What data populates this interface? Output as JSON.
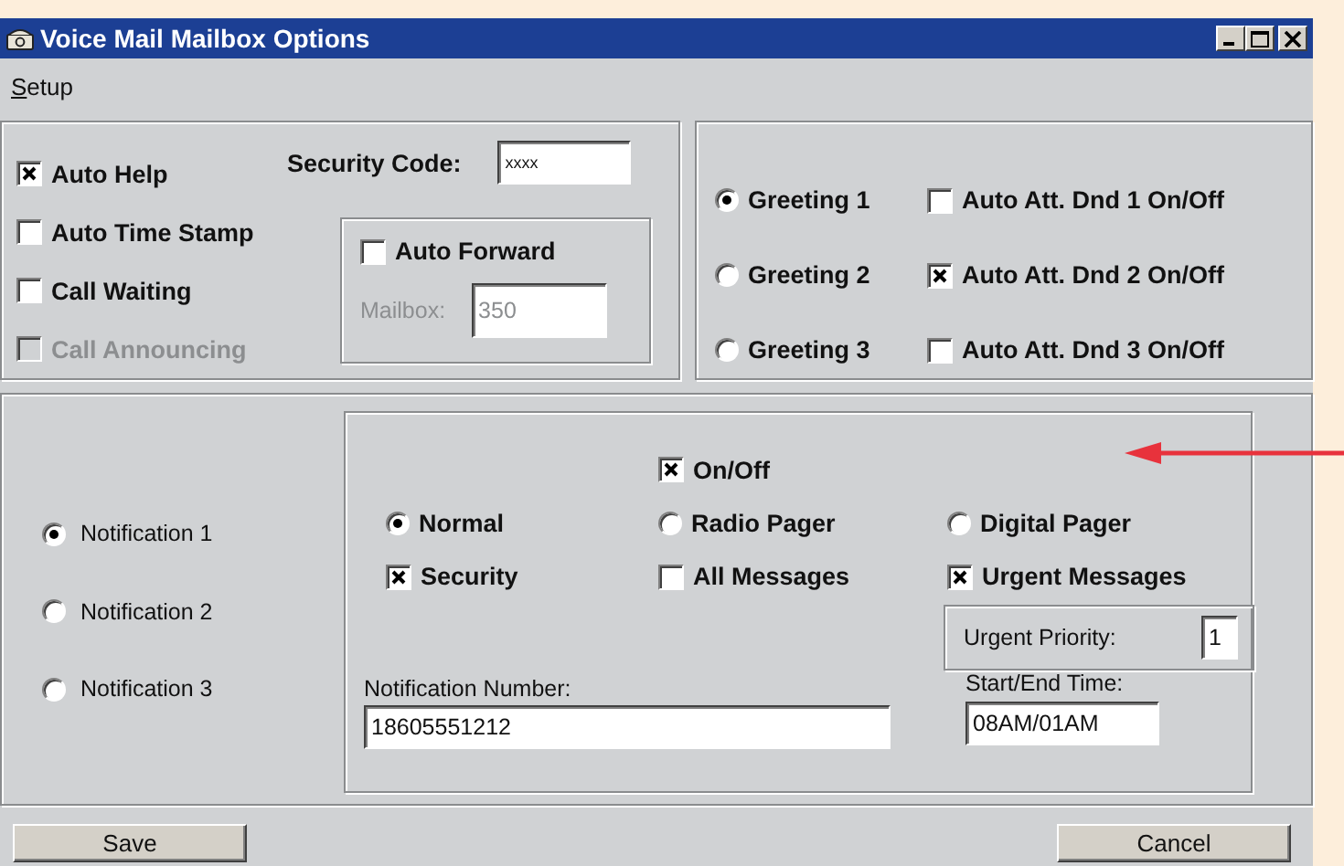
{
  "window": {
    "title": "Voice Mail Mailbox Options"
  },
  "menu": [
    {
      "label": "Setup"
    }
  ],
  "options": [
    {
      "label": "Auto Help",
      "checked": true,
      "disabled": false
    },
    {
      "label": "Auto Time Stamp",
      "checked": false,
      "disabled": false
    },
    {
      "label": "Call Waiting",
      "checked": false,
      "disabled": false
    },
    {
      "label": "Call Announcing",
      "checked": false,
      "disabled": true
    }
  ],
  "security_code": {
    "label": "Security Code:",
    "value": "xxxx"
  },
  "auto_forward": {
    "label": "Auto Forward",
    "checked": false,
    "mailbox_label": "Mailbox:",
    "mailbox_value": "350",
    "disabled": true
  },
  "greetings": [
    {
      "label": "Greeting 1",
      "selected": true
    },
    {
      "label": "Greeting 2",
      "selected": false
    },
    {
      "label": "Greeting 3",
      "selected": false
    }
  ],
  "auto_attendant": [
    {
      "label": "Auto Att. Dnd 1 On/Off",
      "checked": false
    },
    {
      "label": "Auto Att. Dnd 2 On/Off",
      "checked": true
    },
    {
      "label": "Auto Att. Dnd 3 On/Off",
      "checked": false
    }
  ],
  "notifications": [
    {
      "label": "Notification 1",
      "selected": true
    },
    {
      "label": "Notification 2",
      "selected": false
    },
    {
      "label": "Notification 3",
      "selected": false
    }
  ],
  "notification_settings": {
    "on_off": {
      "label": "On/Off",
      "checked": true
    },
    "types": [
      {
        "label": "Normal",
        "selected": true
      },
      {
        "label": "Radio Pager",
        "selected": false
      },
      {
        "label": "Digital Pager",
        "selected": false
      }
    ],
    "messages": [
      {
        "label": "Security",
        "checked": true
      },
      {
        "label": "All Messages",
        "checked": false
      },
      {
        "label": "Urgent Messages",
        "checked": true
      }
    ],
    "urgent_priority": {
      "label": "Urgent Priority:",
      "value": "1"
    },
    "number": {
      "label": "Notification Number:",
      "value": "18605551212"
    },
    "time": {
      "label": "Start/End Time:",
      "value": "08AM/01AM"
    }
  },
  "buttons": [
    "Save",
    "Cancel"
  ]
}
